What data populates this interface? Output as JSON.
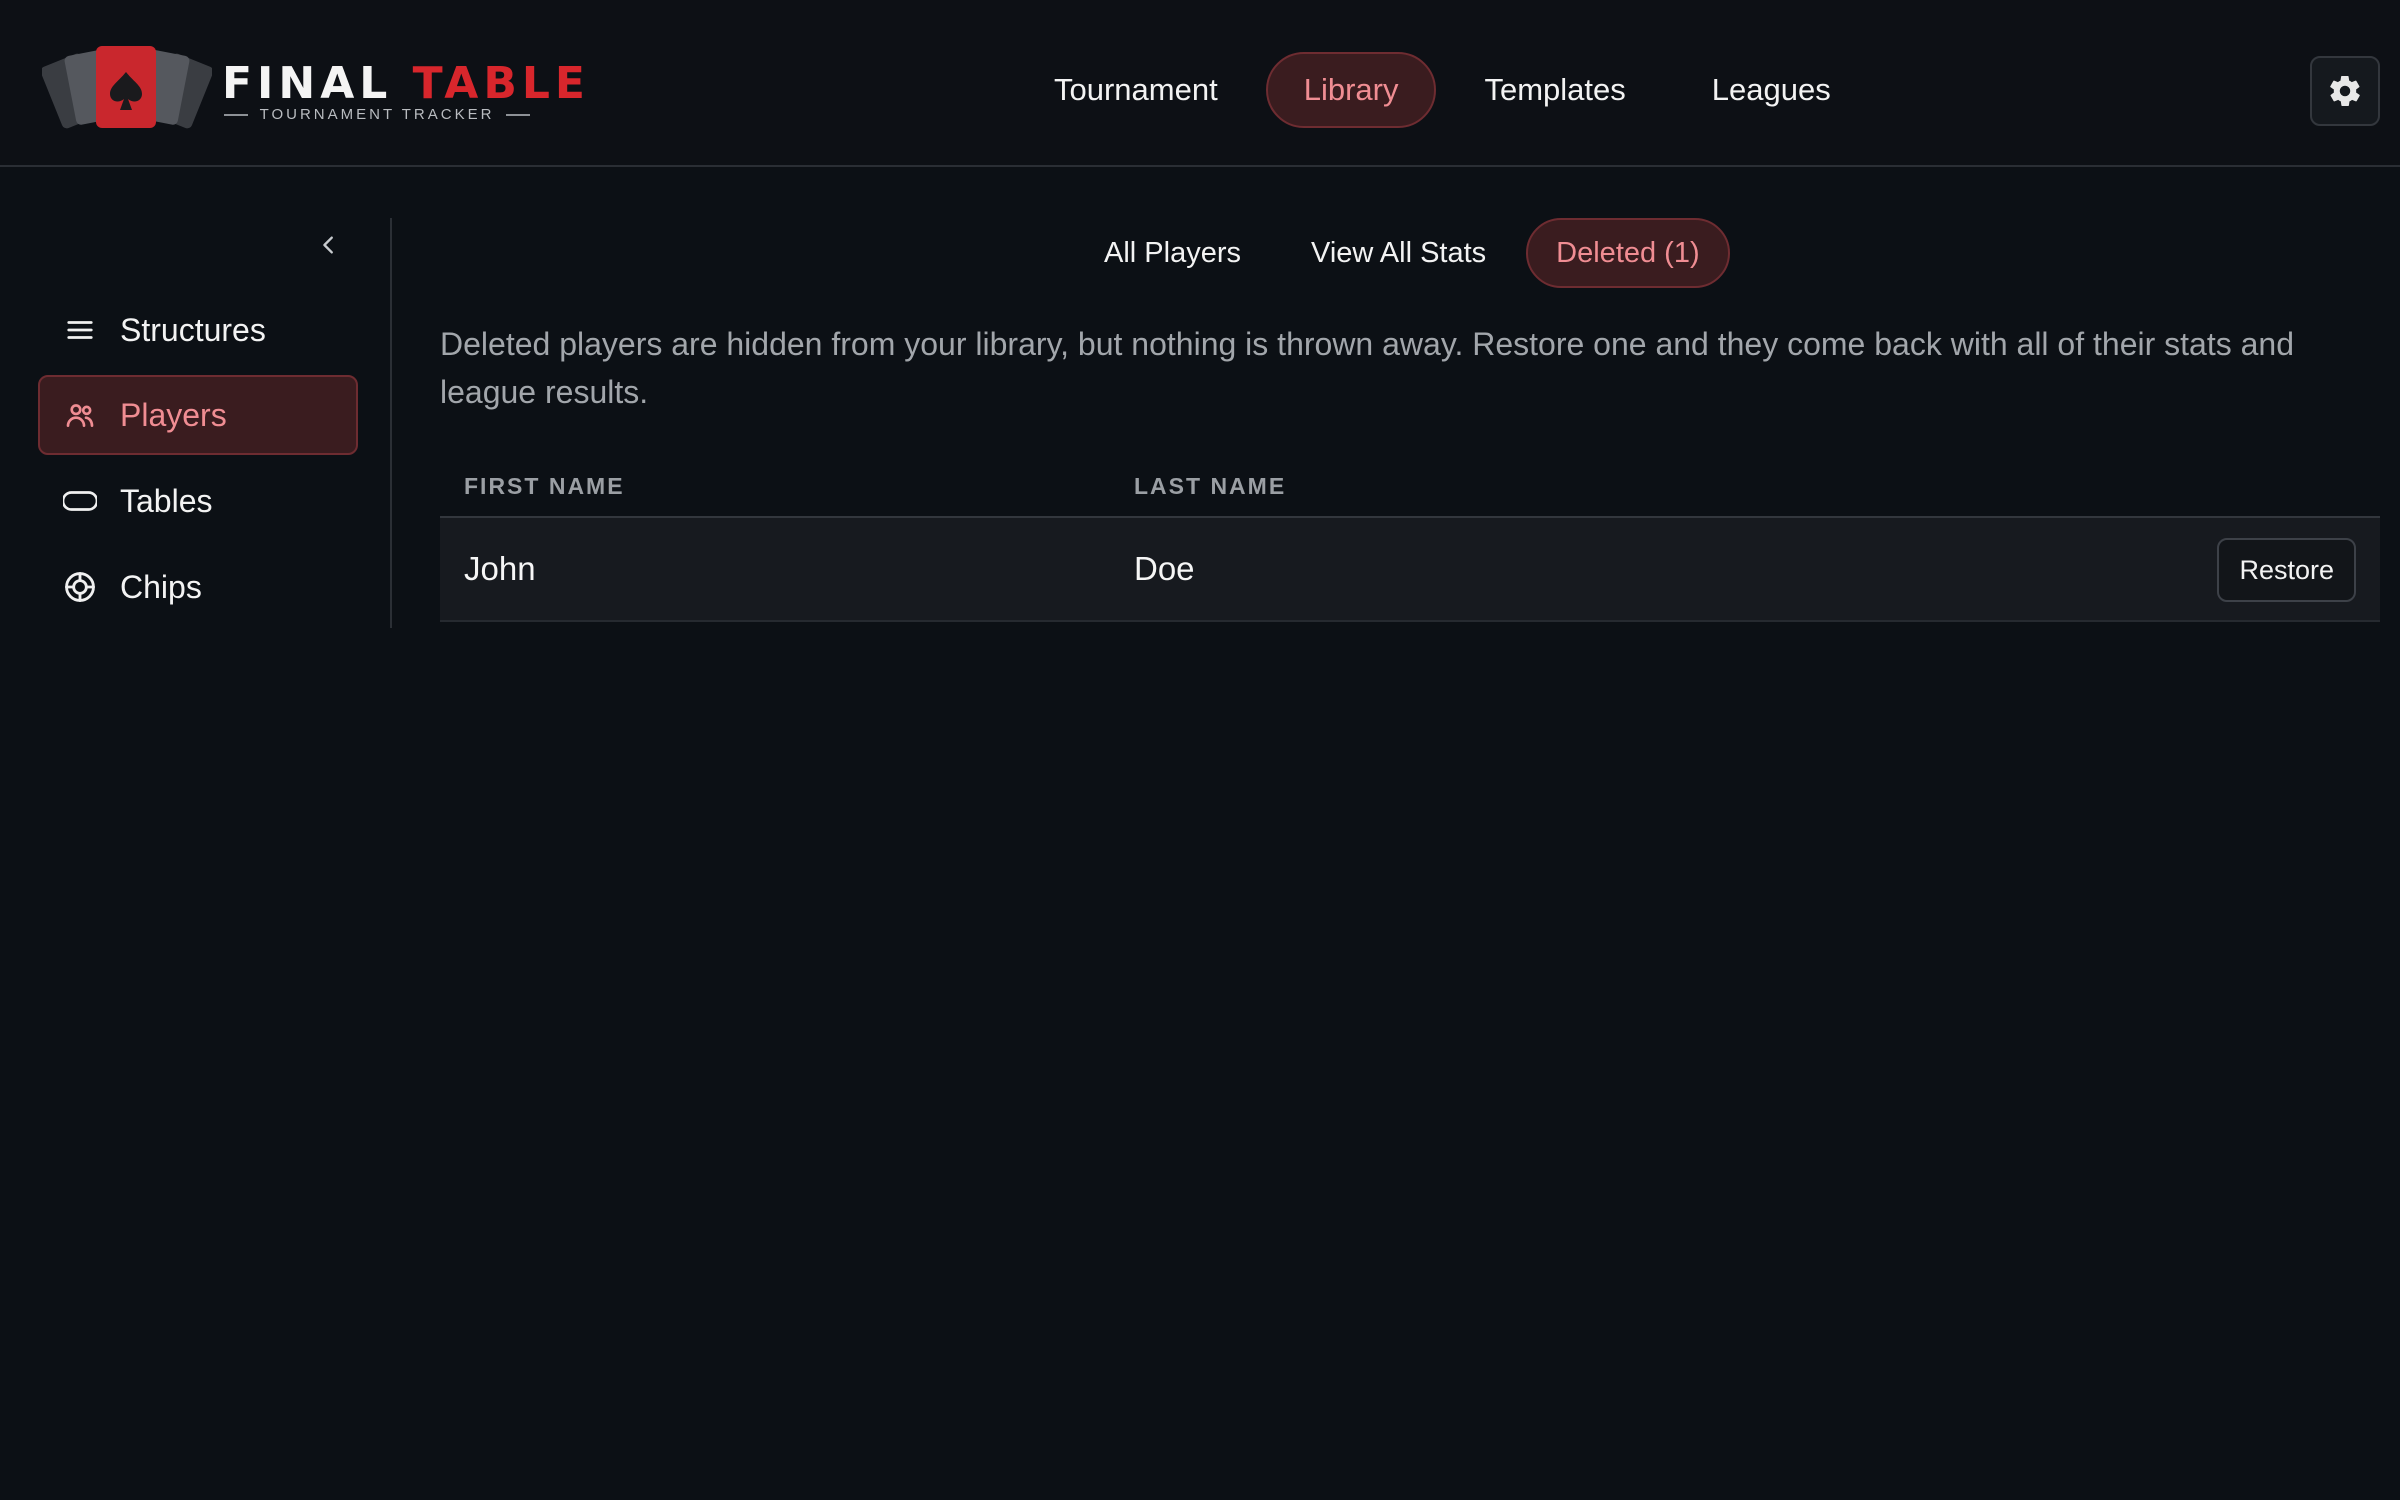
{
  "brand": {
    "word1": "FINAL",
    "word2": "TABLE",
    "subtitle": "TOURNAMENT TRACKER",
    "accent": "#d8262c"
  },
  "top_nav": {
    "items": [
      {
        "label": "Tournament",
        "active": false
      },
      {
        "label": "Library",
        "active": true
      },
      {
        "label": "Templates",
        "active": false
      },
      {
        "label": "Leagues",
        "active": false
      }
    ],
    "settings_icon": "gear-icon"
  },
  "sidebar": {
    "collapse_icon": "chevron-left-icon",
    "items": [
      {
        "label": "Structures",
        "icon": "list-icon",
        "active": false
      },
      {
        "label": "Players",
        "icon": "users-icon",
        "active": true
      },
      {
        "label": "Tables",
        "icon": "table-icon",
        "active": false
      },
      {
        "label": "Chips",
        "icon": "chip-icon",
        "active": false
      }
    ]
  },
  "subtabs": [
    {
      "label": "All Players",
      "active": false
    },
    {
      "label": "View All Stats",
      "active": false
    },
    {
      "label": "Deleted (1)",
      "active": true
    }
  ],
  "info_text": "Deleted players are hidden from your library, but nothing is thrown away. Restore one and they come back with all of their stats and league results.",
  "table": {
    "columns": [
      "FIRST NAME",
      "LAST NAME"
    ],
    "rows": [
      {
        "first": "John",
        "last": "Doe",
        "action": "Restore"
      }
    ]
  },
  "colors": {
    "background": "#0c1015",
    "active_bg": "#3a1c1f",
    "active_border": "#6e2c31",
    "active_text": "#f08d93"
  }
}
